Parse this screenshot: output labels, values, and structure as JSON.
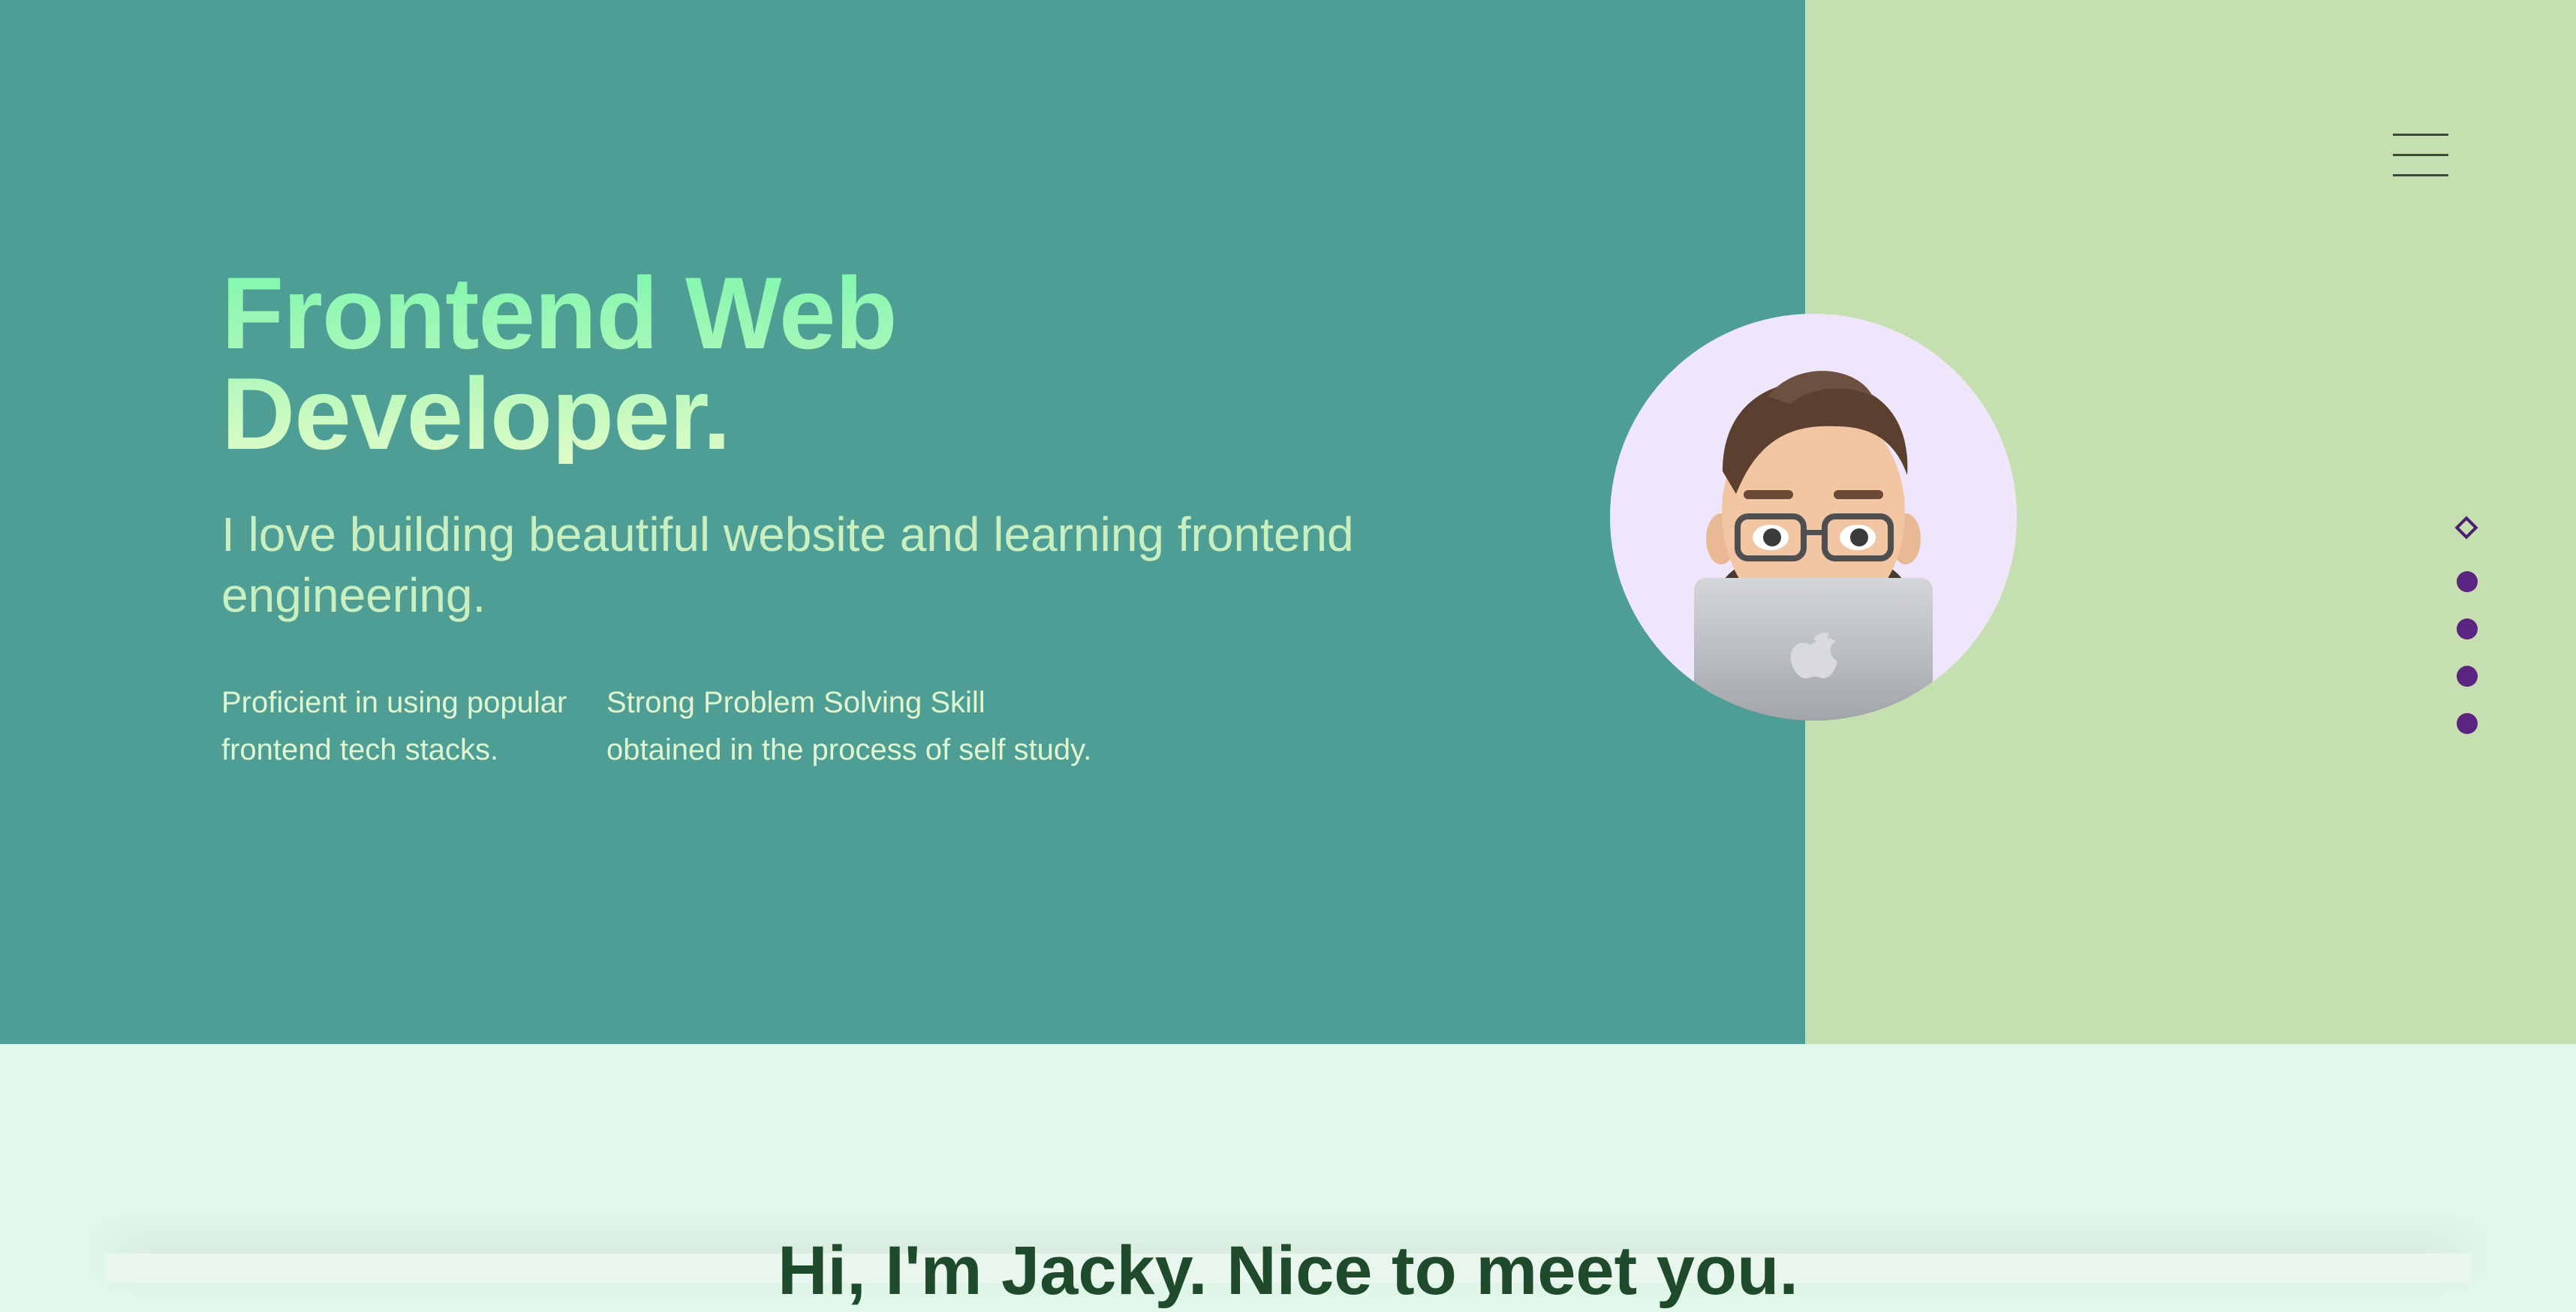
{
  "nav": {
    "menu_icon": "hamburger-menu-icon"
  },
  "hero": {
    "title_line1": "Frontend Web",
    "title_line2": "Developer.",
    "subtitle": "I love building beautiful website and learning frontend engineering.",
    "features": [
      {
        "line1": "Proficient in using popular",
        "line2": "frontend tech stacks."
      },
      {
        "line1": "Strong Problem Solving Skill",
        "line2": "obtained in the process of self study."
      }
    ],
    "avatar_icon": "memoji-avatar-with-laptop"
  },
  "section_nav": {
    "items": [
      "diamond-marker-icon",
      "dot-icon",
      "dot-icon",
      "dot-icon",
      "dot-icon"
    ],
    "active_index": 0
  },
  "about": {
    "greeting": "Hi, I'm Jacky. Nice to meet you."
  },
  "colors": {
    "hero_left_bg": "#4e9e95",
    "hero_right_bg": "#c6dfb1",
    "page_bg": "#e2f8ea",
    "title_gradient_top": "#7ff7ae",
    "title_gradient_bottom": "#e0fbc8",
    "accent_purple": "#5a2480",
    "greeting_text": "#1f4a2c"
  }
}
